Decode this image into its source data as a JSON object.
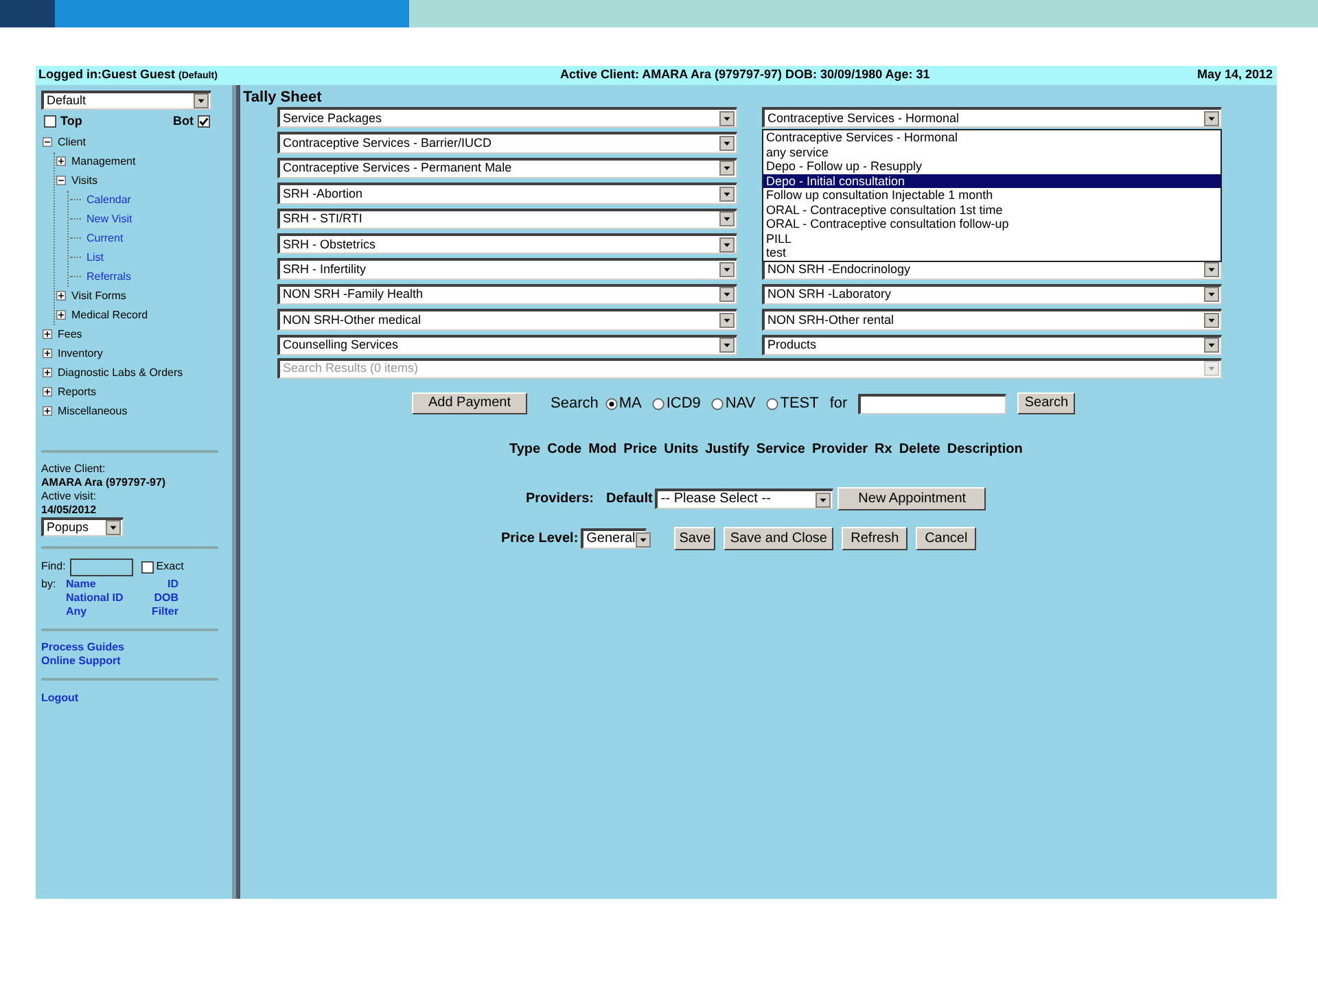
{
  "header": {
    "logged_in": "Logged in:Guest Guest",
    "profile": "(Default)",
    "active_client": "Active Client: AMARA Ara (979797-97) DOB: 30/09/1980 Age: 31",
    "date": "May 14, 2012"
  },
  "sidebar": {
    "view_select": "Default",
    "checkboxes": [
      {
        "label": "Top",
        "checked": false
      },
      {
        "label": "Bot",
        "checked": true
      }
    ],
    "tree": [
      {
        "label": "Client",
        "kind": "folder",
        "expanded": true,
        "children": [
          {
            "label": "Management",
            "kind": "folder",
            "expanded": false
          },
          {
            "label": "Visits",
            "kind": "folder",
            "expanded": true,
            "children": [
              {
                "label": "Calendar",
                "kind": "link"
              },
              {
                "label": "New Visit",
                "kind": "link"
              },
              {
                "label": "Current",
                "kind": "link"
              },
              {
                "label": "List",
                "kind": "link"
              },
              {
                "label": "Referrals",
                "kind": "link"
              }
            ]
          },
          {
            "label": "Visit Forms",
            "kind": "folder",
            "expanded": false
          },
          {
            "label": "Medical Record",
            "kind": "folder",
            "expanded": false
          }
        ]
      },
      {
        "label": "Fees",
        "kind": "folder",
        "expanded": false
      },
      {
        "label": "Inventory",
        "kind": "folder",
        "expanded": false
      },
      {
        "label": "Diagnostic Labs & Orders",
        "kind": "folder",
        "expanded": false
      },
      {
        "label": "Reports",
        "kind": "folder",
        "expanded": false
      },
      {
        "label": "Miscellaneous",
        "kind": "folder",
        "expanded": false
      }
    ],
    "active_client_label": "Active Client:",
    "active_client": "AMARA Ara (979797-97)",
    "active_visit_label": "Active visit:",
    "active_visit": "14/05/2012",
    "popups_select": "Popups",
    "find_label": "Find:",
    "exact": {
      "label": "Exact",
      "checked": false
    },
    "by_label": "by:",
    "find_by": [
      "Name",
      "ID",
      "National ID",
      "DOB",
      "Any",
      "Filter"
    ],
    "links": [
      "Process Guides",
      "Online Support"
    ],
    "logout": "Logout"
  },
  "main": {
    "title": "Tally Sheet",
    "left_selects": [
      "Service Packages",
      "Contraceptive Services - Barrier/IUCD",
      "Contraceptive Services - Permanent Male",
      "SRH -Abortion",
      "SRH - STI/RTI",
      "SRH - Obstetrics",
      "SRH - Infertility",
      "NON SRH -Family Health",
      "NON SRH-Other medical",
      "Counselling Services"
    ],
    "right_selects": [
      "Contraceptive Services - Hormonal",
      "NON SRH -Endocrinology",
      "NON SRH -Laboratory",
      "NON SRH-Other rental",
      "Products"
    ],
    "open_list": [
      {
        "label": "Contraceptive Services - Hormonal",
        "selected": false
      },
      {
        "label": "any service",
        "selected": false
      },
      {
        "label": "Depo - Follow up - Resupply",
        "selected": false
      },
      {
        "label": "Depo - Initial consultation",
        "selected": true
      },
      {
        "label": "Follow up consultation Injectable 1 month",
        "selected": false
      },
      {
        "label": "ORAL - Contraceptive consultation 1st time",
        "selected": false
      },
      {
        "label": "ORAL - Contraceptive consultation follow-up",
        "selected": false
      },
      {
        "label": "PILL",
        "selected": false
      },
      {
        "label": "test",
        "selected": false
      }
    ],
    "search_results": "Search Results (0 items)",
    "add_payment": "Add Payment",
    "search_label": "Search",
    "search_types": [
      {
        "label": "MA",
        "selected": true
      },
      {
        "label": "ICD9",
        "selected": false
      },
      {
        "label": "NAV",
        "selected": false
      },
      {
        "label": "TEST",
        "selected": false
      }
    ],
    "for_label": "for",
    "search_button": "Search",
    "columns": [
      "Type",
      "Code",
      "Mod",
      "Price",
      "Units",
      "Justify",
      "Service",
      "Provider",
      "Rx",
      "Delete",
      "Description"
    ],
    "providers_label": "Providers:",
    "providers_default": "Default",
    "providers_select": "-- Please Select --",
    "new_appointment": "New Appointment",
    "price_level_label": "Price Level:",
    "price_level": "General",
    "buttons": [
      "Save",
      "Save and Close",
      "Refresh",
      "Cancel"
    ]
  }
}
